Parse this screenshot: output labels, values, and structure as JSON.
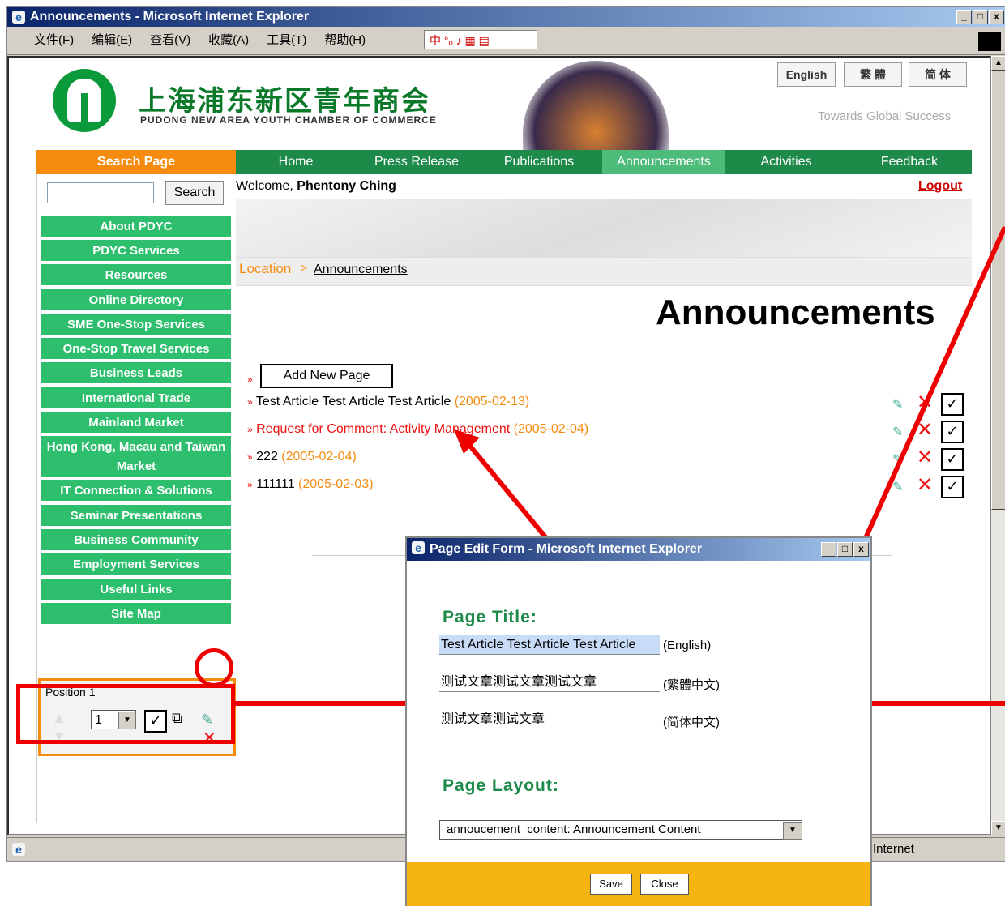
{
  "window": {
    "title": "Announcements - Microsoft Internet Explorer",
    "min_glyph": "_",
    "max_glyph": "□",
    "close_glyph": "x"
  },
  "menu": {
    "items": [
      "文件(F)",
      "编辑(E)",
      "查看(V)",
      "收藏(A)",
      "工具(T)",
      "帮助(H)"
    ],
    "ime_text": "中 °ₒ ♪ ▦ ▤"
  },
  "status": {
    "zone": "Internet"
  },
  "site": {
    "name_cn": "上海浦东新区青年商会",
    "name_en": "PUDONG NEW AREA YOUTH CHAMBER OF COMMERCE",
    "tagline": "Towards Global Success",
    "lang_buttons": [
      "English",
      "繁 體",
      "简 体"
    ]
  },
  "nav": {
    "search_tab": "Search Page",
    "items": [
      "Home",
      "Press Release",
      "Publications",
      "Announcements",
      "Activities",
      "Feedback"
    ],
    "active": "Announcements"
  },
  "sidebar": {
    "search_button": "Search",
    "items": [
      "About PDYC",
      "PDYC Services",
      "Resources",
      "Online Directory",
      "SME One-Stop Services",
      "One-Stop Travel Services",
      "Business Leads",
      "International Trade",
      "Mainland Market",
      "Hong Kong, Macau and Taiwan Market",
      "IT Connection & Solutions",
      "Seminar Presentations",
      "Business Community",
      "Employment Services",
      "Useful Links",
      "Site Map"
    ]
  },
  "user": {
    "welcome_prefix": "Welcome, ",
    "name": "Phentony Ching",
    "logout": "Logout"
  },
  "breadcrumb": {
    "location": "Location",
    "separator": ">",
    "current": "Announcements"
  },
  "main": {
    "title": "Announcements",
    "bullet": "»",
    "add_button": "Add New Page",
    "articles": [
      {
        "title": "Test Article Test Article Test Article",
        "date": "(2005-02-13)",
        "highlight": false
      },
      {
        "title": "Request for Comment: Activity Management",
        "date": "(2005-02-04)",
        "highlight": true
      },
      {
        "title": "222",
        "date": "(2005-02-04)",
        "highlight": false
      },
      {
        "title": "111111",
        "date": "(2005-02-03)",
        "highlight": false
      }
    ],
    "delete_glyph": "✕",
    "check_glyph": "✓"
  },
  "position_panel": {
    "label": "Position 1",
    "value": "1"
  },
  "popup": {
    "title": "Page Edit Form - Microsoft Internet Explorer",
    "page_title_label": "Page Title:",
    "fields": [
      {
        "value": "Test Article Test Article Test Article",
        "lang": "(English)"
      },
      {
        "value": "测试文章测试文章测试文章",
        "lang": "(繁體中文)"
      },
      {
        "value": "测试文章测试文章",
        "lang": "(简体中文)"
      }
    ],
    "page_layout_label": "Page Layout:",
    "layout_value": "annoucement_content: Announcement Content",
    "save": "Save",
    "close": "Close"
  },
  "colors": {
    "nav_green": "#1e8a4a",
    "side_green": "#2ebf6e",
    "accent_orange": "#f58c10",
    "annotation_red": "#e00000",
    "footer_yellow": "#f5b40f"
  }
}
